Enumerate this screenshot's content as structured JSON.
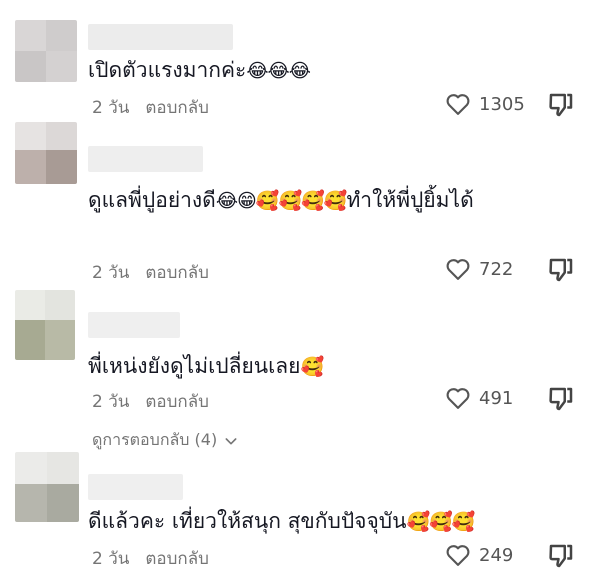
{
  "comments": [
    {
      "text": "เปิดตัวแรงมากค่ะ",
      "emoji": "😂😂😂",
      "time": "2 วัน",
      "reply": "ตอบกลับ",
      "likes": "1305"
    },
    {
      "text": "ดูแลพี่ปูอย่างดี",
      "emoji": "😂😁🥰🥰🥰🥰",
      "text_after": "ทำให้พี่ปูยิ้มได้",
      "time": "2 วัน",
      "reply": "ตอบกลับ",
      "likes": "722"
    },
    {
      "text": "พี่เหน่งยังดูไม่เปลี่ยนเลย",
      "emoji": "🥰",
      "time": "2 วัน",
      "reply": "ตอบกลับ",
      "likes": "491"
    },
    {
      "text": "ดีแล้วคะ เที่ยวให้สนุก สุขกับปัจจุบัน",
      "emoji": "🥰🥰🥰",
      "time": "2 วัน",
      "reply": "ตอบกลับ",
      "likes": "249"
    }
  ],
  "view_replies": "ดูการตอบกลับ (4)",
  "icons": {
    "like": "heart-outline-icon",
    "dislike": "thumbs-down-icon",
    "expand": "chevron-down-icon"
  },
  "colors": {
    "text": "#161823",
    "meta": "#757575",
    "background": "#ffffff"
  }
}
